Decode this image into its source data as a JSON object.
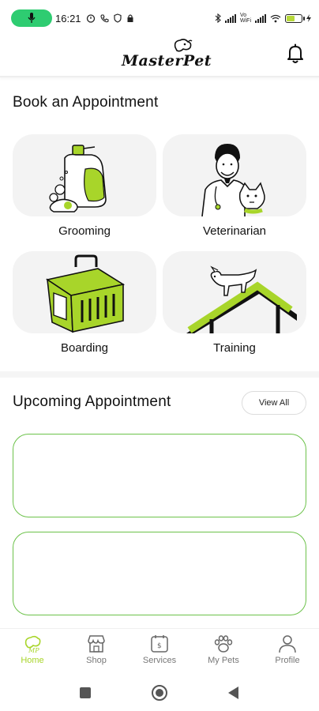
{
  "status_bar": {
    "time": "16:21",
    "network_label": "Vo WiFi",
    "colors": {
      "mic_pill": "#2ecc71",
      "battery_fill": "#b7d93a"
    },
    "icons": [
      "mic-icon",
      "alarm-icon",
      "phone-icon",
      "shield-icon",
      "lock-icon",
      "bluetooth-icon",
      "signal-icon",
      "wifi-icon",
      "battery-icon"
    ]
  },
  "header": {
    "logo_text": "MasterPet",
    "icons": [
      "logo-dog-icon",
      "bell-icon"
    ]
  },
  "book": {
    "title": "Book an Appointment",
    "services": [
      {
        "label": "Grooming",
        "icon": "grooming-illustration"
      },
      {
        "label": "Veterinarian",
        "icon": "veterinarian-illustration"
      },
      {
        "label": "Boarding",
        "icon": "pet-carrier-illustration"
      },
      {
        "label": "Training",
        "icon": "dog-training-illustration"
      }
    ]
  },
  "upcoming": {
    "title": "Upcoming Appointment",
    "view_all_label": "View All",
    "cards": [
      {},
      {}
    ]
  },
  "bottom_nav": {
    "items": [
      {
        "label": "Home",
        "icon": "home-logo-icon",
        "active": true
      },
      {
        "label": "Shop",
        "icon": "shop-icon",
        "active": false
      },
      {
        "label": "Services",
        "icon": "services-icon",
        "active": false
      },
      {
        "label": "My Pets",
        "icon": "paw-icon",
        "active": false
      },
      {
        "label": "Profile",
        "icon": "profile-icon",
        "active": false
      }
    ]
  },
  "theme": {
    "accent": "#a8d52a",
    "card_border": "#6cc24a",
    "card_bg": "#f3f3f3"
  }
}
